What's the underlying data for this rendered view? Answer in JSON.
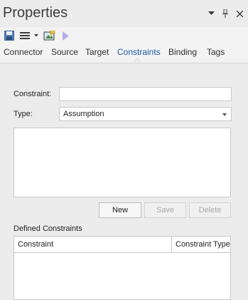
{
  "window": {
    "title": "Properties",
    "controls": [
      "dropdown",
      "pin",
      "close"
    ]
  },
  "toolbar": {
    "icons": [
      "save-icon",
      "menu-icon",
      "dropdown-arrow",
      "image-icon",
      "play-icon"
    ]
  },
  "tabs": [
    {
      "label": "Connector",
      "active": false
    },
    {
      "label": "Source",
      "active": false
    },
    {
      "label": "Target",
      "active": false
    },
    {
      "label": "Constraints",
      "active": true
    },
    {
      "label": "Binding",
      "active": false
    },
    {
      "label": "Tags",
      "active": false
    }
  ],
  "form": {
    "constraint_label": "Constraint:",
    "constraint_value": "",
    "type_label": "Type:",
    "type_value": "Assumption",
    "notes_value": ""
  },
  "buttons": {
    "new": "New",
    "save": "Save",
    "delete": "Delete"
  },
  "defined": {
    "section_label": "Defined Constraints",
    "columns": [
      "Constraint",
      "Constraint Type"
    ],
    "rows": []
  },
  "colors": {
    "active_tab": "#1f5aa6",
    "background": "#ececec"
  }
}
